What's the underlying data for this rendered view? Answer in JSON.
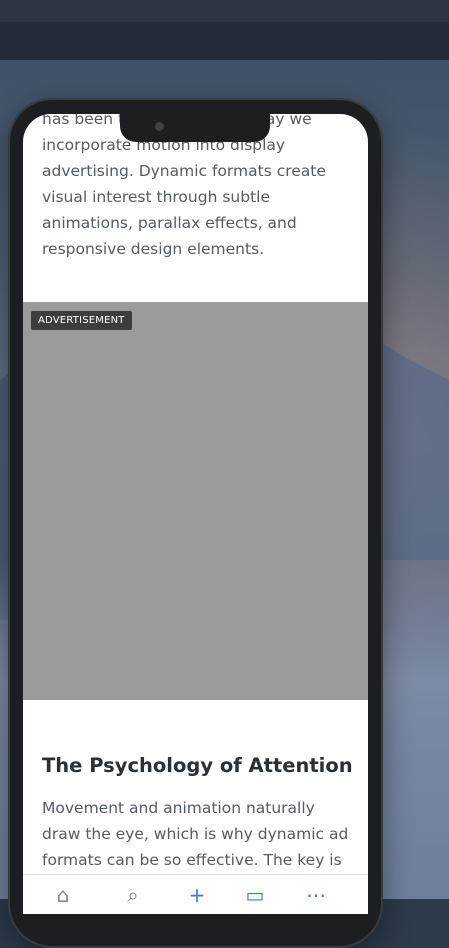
{
  "article": {
    "paragraph_before": "has been transforming the way we incorporate motion into display advertising. Dynamic formats create visual interest through subtle animations, parallax effects, and responsive design elements.",
    "ad_label": "ADVERTISEMENT",
    "section_heading": "The Psychology of Attention",
    "paragraph_after": "Movement and animation naturally draw the eye, which is why dynamic ad formats can be so effective. The key is"
  },
  "bottom_nav": {
    "items": [
      {
        "icon": "home-icon",
        "glyph": "⌂"
      },
      {
        "icon": "search-icon",
        "glyph": "⌕"
      },
      {
        "icon": "plus-icon",
        "glyph": "+"
      },
      {
        "icon": "bookmark-icon",
        "glyph": "▭"
      },
      {
        "icon": "more-icon",
        "glyph": "⋯"
      }
    ]
  },
  "colors": {
    "accent": "#3a7bd5",
    "ad_background": "#9b9b9b"
  }
}
